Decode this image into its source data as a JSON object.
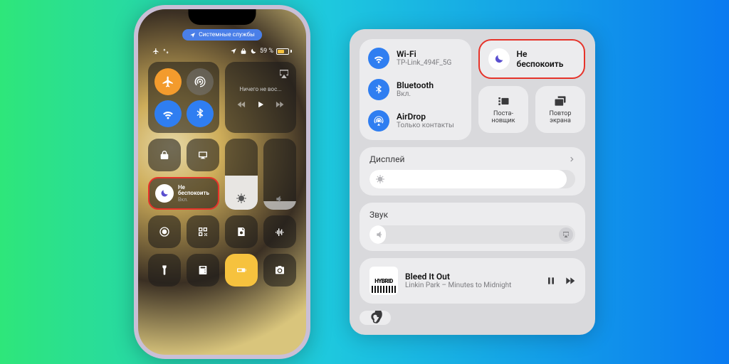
{
  "status_pill": "Системные службы",
  "battery_pct": "59 %",
  "media_phone_label": "Ничего не вос...",
  "focus": {
    "title": "Не беспокоить",
    "state": "Вкл."
  },
  "panel": {
    "wifi": {
      "title": "Wi-Fi",
      "sub": "TP-Link_494F_5G"
    },
    "bt": {
      "title": "Bluetooth",
      "sub": "Вкл."
    },
    "airdrop": {
      "title": "AirDrop",
      "sub": "Только контакты"
    },
    "dnd": "Не беспокоить",
    "stage": "Поста-\nновщик",
    "mirror": "Повтор\nэкрана",
    "display": "Дисплей",
    "sound": "Звук",
    "track": {
      "title": "Bleed It Out",
      "artist": "Linkin Park – Minutes to Midnight",
      "art": "HYBRID"
    }
  },
  "brightness_pct": 96,
  "volume_pct": 8
}
